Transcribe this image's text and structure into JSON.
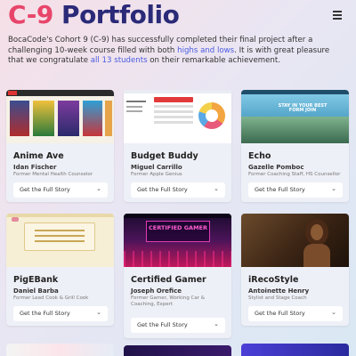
{
  "header": {
    "title_prefix": "C-9",
    "title_suffix": "Portfolio"
  },
  "intro": {
    "part1": "BocaCode's Cohort 9 (C-9) has successfully completed their final project after a challenging 10-week course filled with both ",
    "highlight1": "highs and lows",
    "part2": ". It is with great pleasure that we congratulate ",
    "highlight2": "all 13 students",
    "part3": " on their remarkable achievement."
  },
  "cards": [
    {
      "name": "Anime Ave",
      "author": "Idan Fischer",
      "role": "Former Mental Health Counselor",
      "story": "Get the Full Story"
    },
    {
      "name": "Budget Buddy",
      "author": "Miguel Carrillo",
      "role": "Former Apple Genius",
      "story": "Get the Full Story"
    },
    {
      "name": "Echo",
      "author": "Gazelle Pomboc",
      "role": "Former Coaching Staff, HS Counsellor",
      "story": "Get the Full Story"
    },
    {
      "name": "PigEBank",
      "author": "Daniel Barba",
      "role": "Former Lead Cook & Grill Cook",
      "story": "Get the Full Story"
    },
    {
      "name": "Certified Gamer",
      "author": "Joseph Orefice",
      "role": "Former Gamer, Working Car & Coaching, Expert",
      "story": "Get the Full Story"
    },
    {
      "name": "iRecoStyle",
      "author": "Antoinette Henry",
      "role": "Stylist and Stage Coach",
      "story": "Get the Full Story"
    }
  ],
  "thumb_text": {
    "budget_title": "Budget Buddy",
    "gamer_title": "CERTIFIED GAMER",
    "echo_title": "STAY IN YOUR BEST FORM JOIN"
  },
  "colors": {
    "accent_red": "#e8456b",
    "accent_navy": "#2a2a78",
    "link_blue": "#4a5be0"
  },
  "icons": {
    "menu": "hamburger-icon",
    "chevron": "chevron-down-icon"
  }
}
